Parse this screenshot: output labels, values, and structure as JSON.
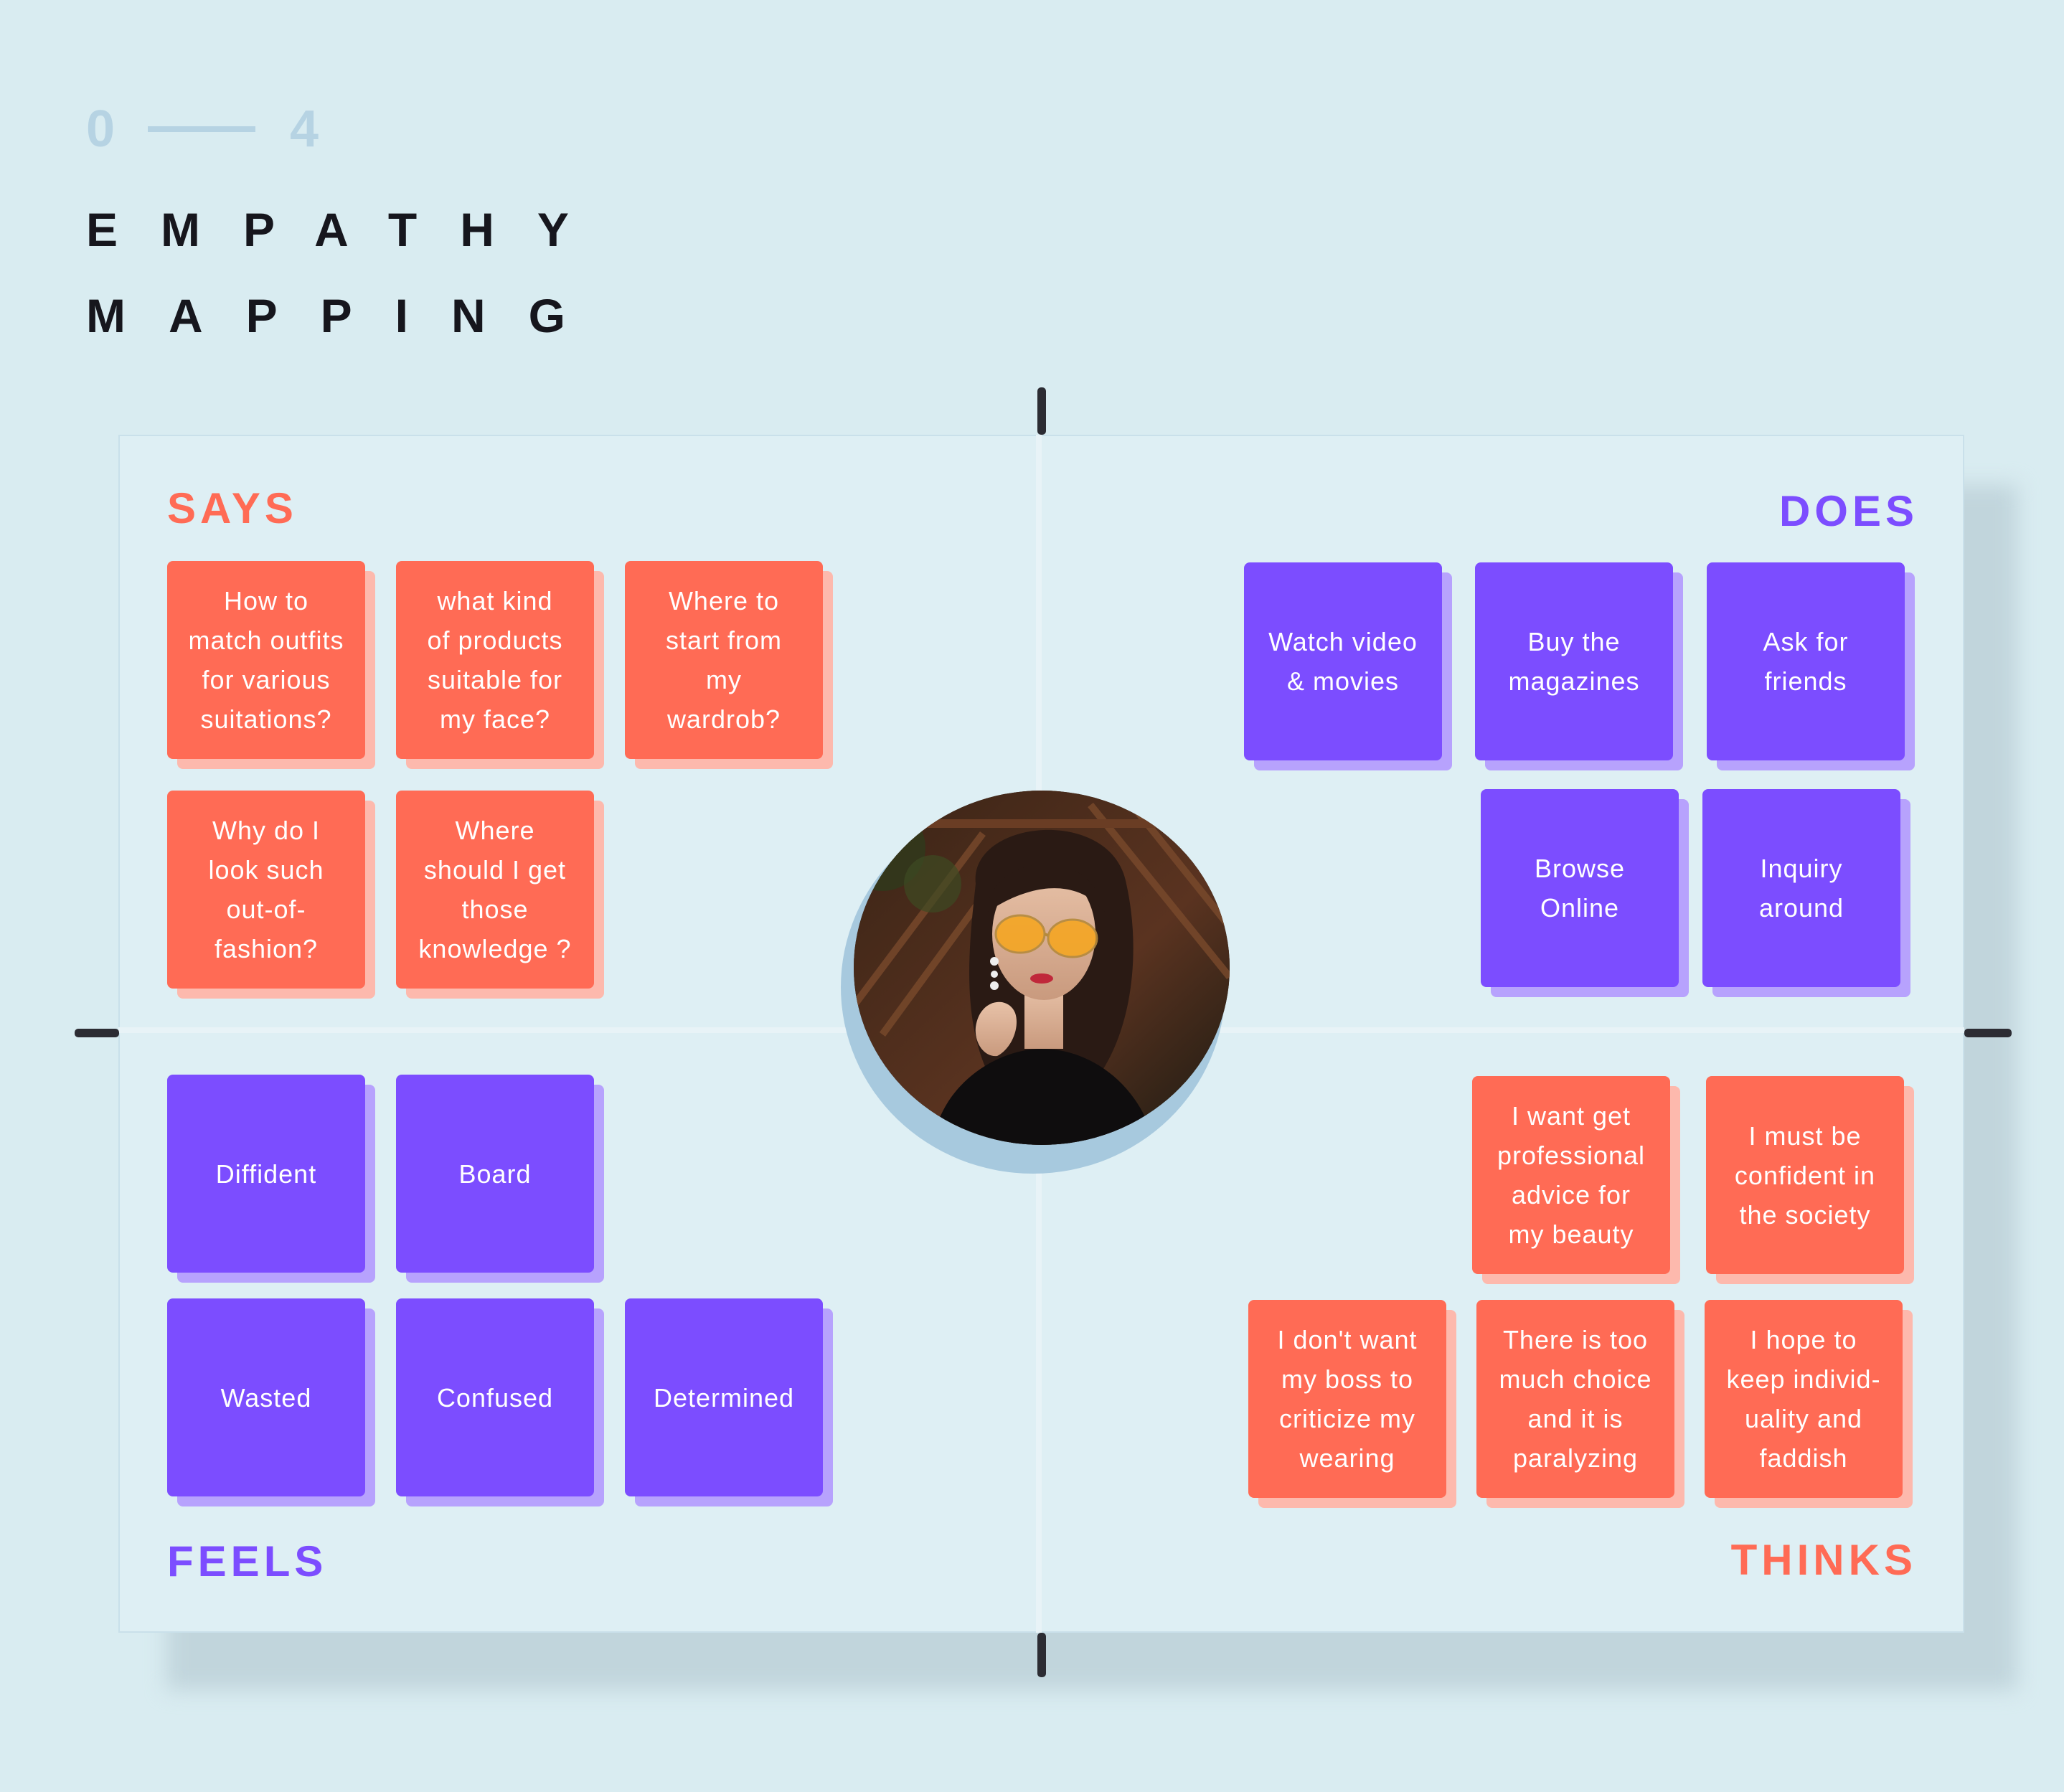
{
  "header": {
    "section_start": "0",
    "section_end": "4",
    "title_line1": "EMPATHY",
    "title_line2": "MAPPING"
  },
  "quadrants": {
    "says": "SAYS",
    "does": "DOES",
    "feels": "FEELS",
    "thinks": "THINKS"
  },
  "says_notes": [
    "How to\nmatch outfits\nfor various\nsuitations?",
    "what kind\nof products\nsuitable for\nmy face?",
    "Where to\nstart from\nmy\nwardrob?",
    "Why do I\nlook such\nout-of-\nfashion?",
    "Where\nshould I get\nthose\nknowledge ?"
  ],
  "does_notes": [
    "Watch video\n& movies",
    "Buy the\nmagazines",
    "Ask for\nfriends",
    "Browse\nOnline",
    "Inquiry\naround"
  ],
  "feels_notes": [
    "Diffident",
    "Board",
    "Wasted",
    "Confused",
    "Determined"
  ],
  "thinks_notes": [
    "I want get\nprofessional\nadvice for\nmy beauty",
    "I must be\nconfident in\nthe society",
    "I don't want\nmy boss to\ncriticize my\nwearing",
    "There is too\nmuch choice\nand  it is\nparalyzing",
    "I hope to\nkeep individ-\nuality and\nfaddish"
  ],
  "colors": {
    "background": "#d9ecf1",
    "coral": "#ff6b55",
    "purple": "#7c4dff",
    "muted_number": "#b6d3e3"
  },
  "persona": {
    "icon": "persona-photo"
  }
}
